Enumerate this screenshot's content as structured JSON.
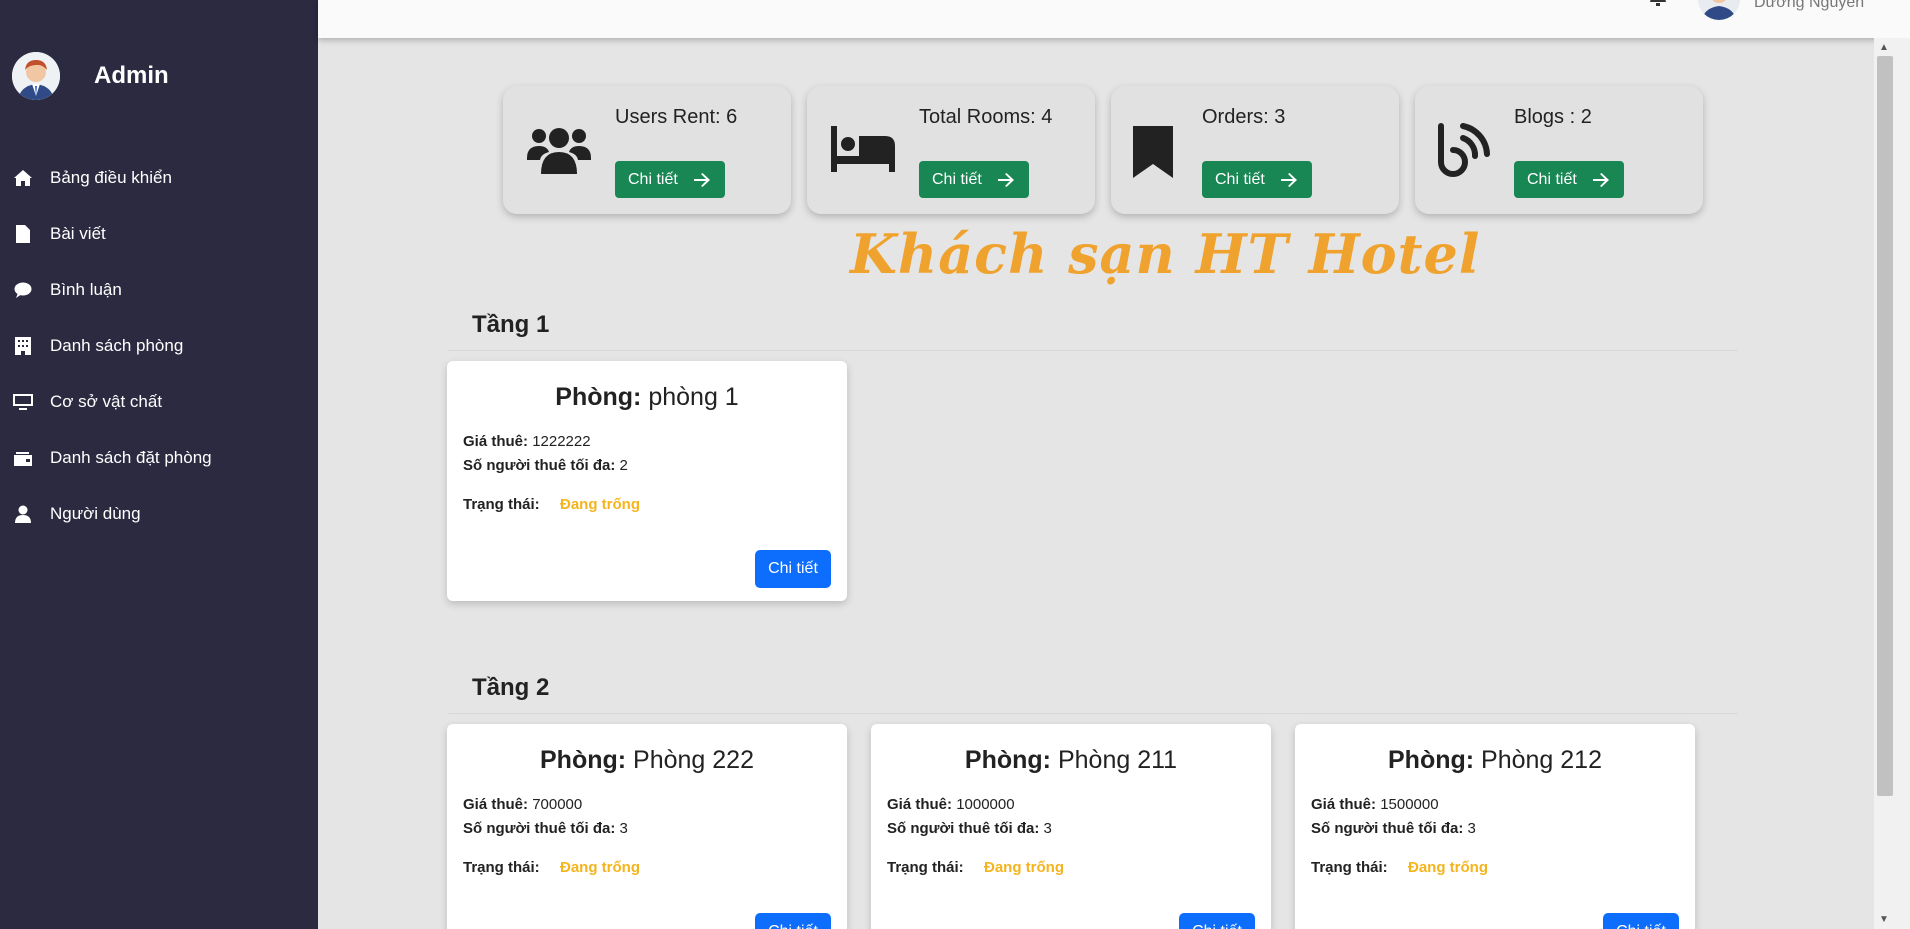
{
  "sidebar": {
    "admin_name": "Admin",
    "items": [
      {
        "label": "Bảng điều khiển",
        "icon": "home-icon"
      },
      {
        "label": "Bài viết",
        "icon": "file-icon"
      },
      {
        "label": "Bình luận",
        "icon": "comment-icon"
      },
      {
        "label": "Danh sách phòng",
        "icon": "building-icon"
      },
      {
        "label": "Cơ sở vật chất",
        "icon": "monitor-icon"
      },
      {
        "label": "Danh sách đặt phòng",
        "icon": "wallet-icon"
      },
      {
        "label": "Người dùng",
        "icon": "user-icon"
      }
    ]
  },
  "topbar": {
    "user_name": "Dương Nguyễn"
  },
  "stats": [
    {
      "title": "Users Rent: 6",
      "button": "Chi tiết",
      "icon": "users-icon"
    },
    {
      "title": "Total Rooms: 4",
      "button": "Chi tiết",
      "icon": "bed-icon"
    },
    {
      "title": "Orders: 3",
      "button": "Chi tiết",
      "icon": "bookmark-icon"
    },
    {
      "title": "Blogs : 2",
      "button": "Chi tiết",
      "icon": "blog-icon"
    }
  ],
  "hotel_title": "Khách sạn HT Hotel",
  "floors": [
    {
      "name": "Tầng 1",
      "rooms": [
        {
          "label": "Phòng:",
          "name": "phòng 1",
          "price_label": "Giá thuê:",
          "price": "1222222",
          "max_label": "Số người thuê tối đa:",
          "max": "2",
          "status_label": "Trạng thái:",
          "status": "Đang trống",
          "button": "Chi tiết"
        }
      ]
    },
    {
      "name": "Tầng 2",
      "rooms": [
        {
          "label": "Phòng:",
          "name": "Phòng 222",
          "price_label": "Giá thuê:",
          "price": "700000",
          "max_label": "Số người thuê tối đa:",
          "max": "3",
          "status_label": "Trạng thái:",
          "status": "Đang trống",
          "button": "Chi tiết"
        },
        {
          "label": "Phòng:",
          "name": "Phòng 211",
          "price_label": "Giá thuê:",
          "price": "1000000",
          "max_label": "Số người thuê tối đa:",
          "max": "3",
          "status_label": "Trạng thái:",
          "status": "Đang trống",
          "button": "Chi tiết"
        },
        {
          "label": "Phòng:",
          "name": "Phòng 212",
          "price_label": "Giá thuê:",
          "price": "1500000",
          "max_label": "Số người thuê tối đa:",
          "max": "3",
          "status_label": "Trạng thái:",
          "status": "Đang trống",
          "button": "Chi tiết"
        }
      ]
    }
  ],
  "colors": {
    "sidebar_bg": "#2b2a40",
    "success_button": "#198754",
    "primary_button": "#0d6efd",
    "status_available": "#f5b41c",
    "hotel_title": "#f0a22e"
  }
}
